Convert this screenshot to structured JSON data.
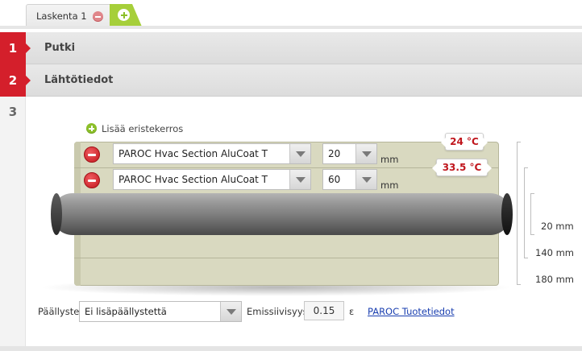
{
  "tabs": [
    {
      "label": "Laskenta 1"
    }
  ],
  "sections": [
    {
      "number": "1",
      "title": "Putki"
    },
    {
      "number": "2",
      "title": "Lähtötiedot"
    },
    {
      "number": "3",
      "title": ""
    }
  ],
  "add_layer": {
    "label": "Lisää eristekerros"
  },
  "layers": [
    {
      "material": "PAROC Hvac Section AluCoat T",
      "thickness": "20",
      "unit": "mm"
    },
    {
      "material": "PAROC Hvac Section AluCoat T",
      "thickness": "60",
      "unit": "mm"
    }
  ],
  "temperatures": {
    "outer": "24 °C",
    "inner": "33.5 °C"
  },
  "dimensions": [
    "20 mm",
    "140 mm",
    "180 mm"
  ],
  "coating": {
    "label": "Päällyste",
    "value": "Ei lisäpäällystettä",
    "emissivity_label": "Emissiivisyys",
    "emissivity_value": "0.15",
    "epsilon_symbol": "ε",
    "product_link": "PAROC Tuotetiedot"
  },
  "colors": {
    "accent_red": "#d41f2b",
    "accent_green": "#a6cf3a",
    "link_blue": "#1a3fb0"
  }
}
